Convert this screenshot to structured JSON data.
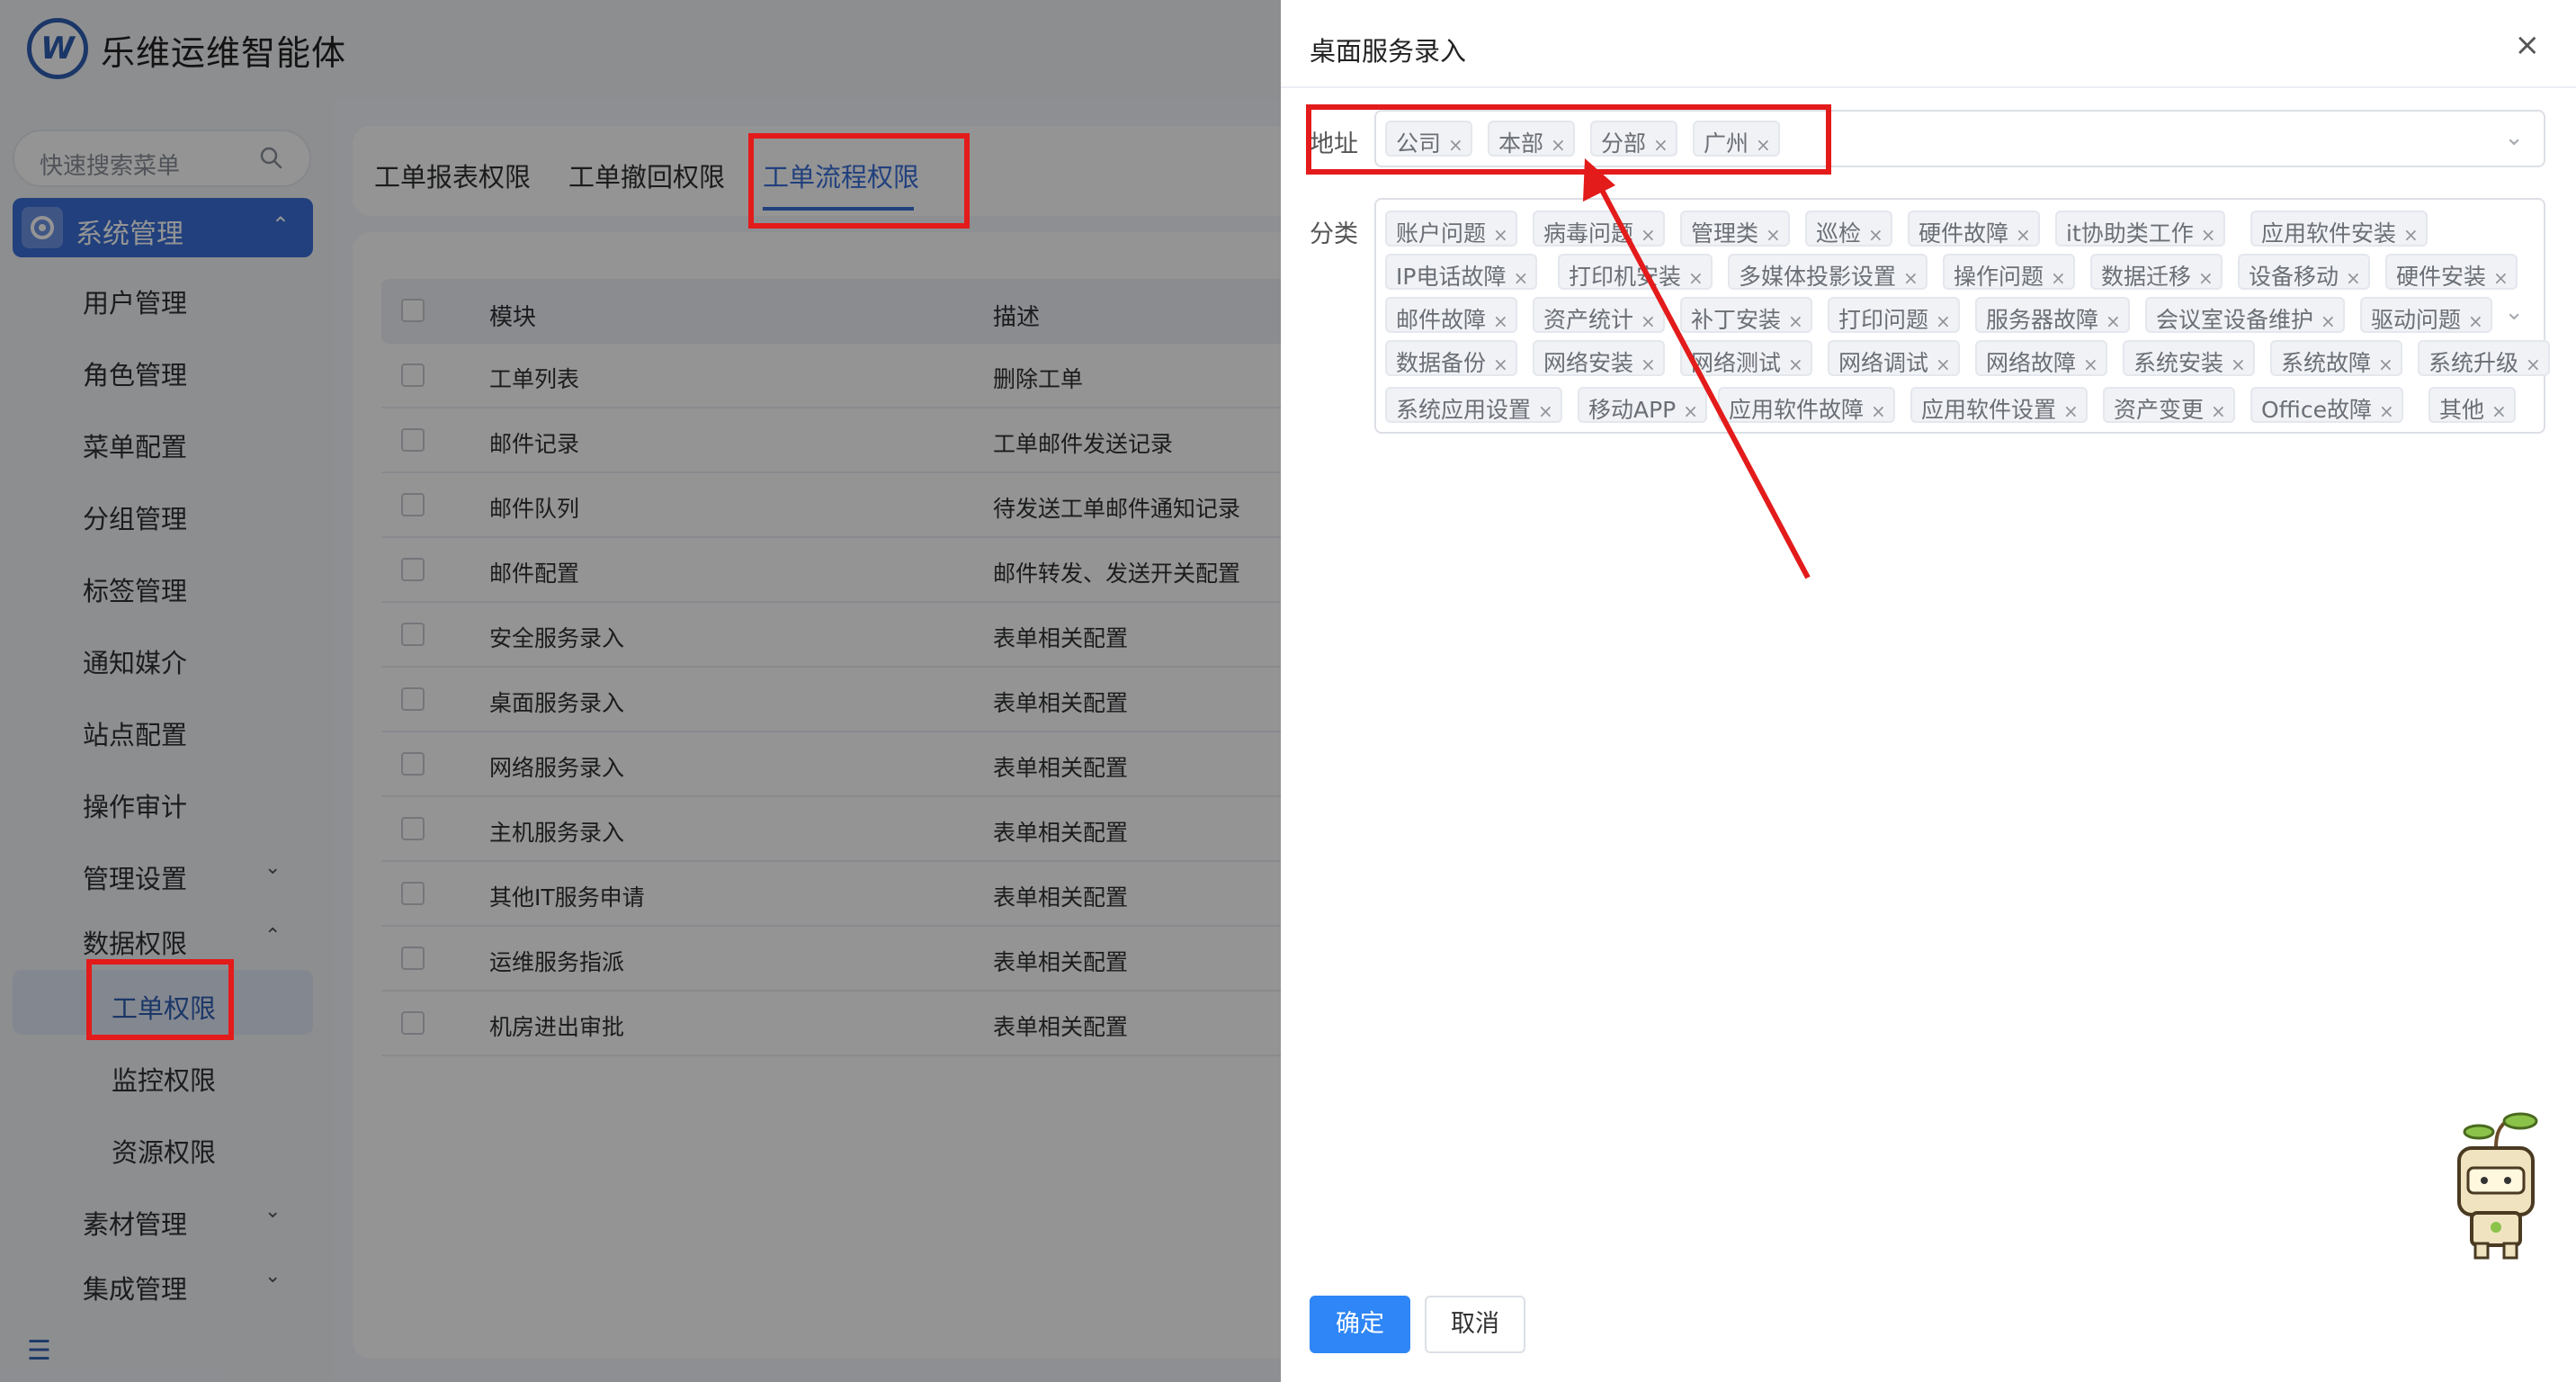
{
  "app": {
    "title": "乐维运维智能体",
    "logo_letter": "W"
  },
  "sidebar": {
    "search_placeholder": "快速搜索菜单",
    "active_parent": "系统管理",
    "items": [
      {
        "label": "用户管理"
      },
      {
        "label": "角色管理"
      },
      {
        "label": "菜单配置"
      },
      {
        "label": "分组管理"
      },
      {
        "label": "标签管理"
      },
      {
        "label": "通知媒介"
      },
      {
        "label": "站点配置"
      },
      {
        "label": "操作审计"
      },
      {
        "label": "管理设置",
        "chevron": "down"
      },
      {
        "label": "数据权限",
        "chevron": "up"
      },
      {
        "label": "工单权限",
        "selected": true
      },
      {
        "label": "监控权限"
      },
      {
        "label": "资源权限"
      },
      {
        "label": "素材管理",
        "chevron": "down"
      },
      {
        "label": "集成管理",
        "chevron": "down"
      }
    ]
  },
  "tabs": [
    {
      "label": "工单报表权限"
    },
    {
      "label": "工单撤回权限"
    },
    {
      "label": "工单流程权限",
      "active": true
    }
  ],
  "table": {
    "headers": [
      "模块",
      "描述"
    ],
    "rows": [
      [
        "工单列表",
        "删除工单"
      ],
      [
        "邮件记录",
        "工单邮件发送记录"
      ],
      [
        "邮件队列",
        "待发送工单邮件通知记录"
      ],
      [
        "邮件配置",
        "邮件转发、发送开关配置"
      ],
      [
        "安全服务录入",
        "表单相关配置"
      ],
      [
        "桌面服务录入",
        "表单相关配置"
      ],
      [
        "网络服务录入",
        "表单相关配置"
      ],
      [
        "主机服务录入",
        "表单相关配置"
      ],
      [
        "其他IT服务申请",
        "表单相关配置"
      ],
      [
        "运维服务指派",
        "表单相关配置"
      ],
      [
        "机房进出审批",
        "表单相关配置"
      ]
    ]
  },
  "drawer": {
    "title": "桌面服务录入",
    "close": "×",
    "address_label": "地址",
    "address_tags": [
      "公司",
      "本部",
      "分部",
      "广州"
    ],
    "category_label": "分类",
    "category_rows": [
      [
        "账户问题",
        "病毒问题",
        "管理类",
        "巡检",
        "硬件故障",
        "it协助类工作",
        "应用软件安装"
      ],
      [
        "IP电话故障",
        "打印机安装",
        "多媒体投影设置",
        "操作问题",
        "数据迁移",
        "设备移动",
        "硬件安装"
      ],
      [
        "邮件故障",
        "资产统计",
        "补丁安装",
        "打印问题",
        "服务器故障",
        "会议室设备维护",
        "驱动问题"
      ],
      [
        "数据备份",
        "网络安装",
        "网络测试",
        "网络调试",
        "网络故障",
        "系统安装",
        "系统故障",
        "系统升级"
      ],
      [
        "系统应用设置",
        "移动APP",
        "应用软件故障",
        "应用软件设置",
        "资产变更",
        "Office故障",
        "其他"
      ]
    ],
    "confirm": "确定",
    "cancel": "取消"
  },
  "colors": {
    "primary": "#3a6fd8",
    "button_primary": "#2f86f6",
    "annotation": "#e31b1b"
  },
  "icons": [
    "search-icon",
    "gear-icon",
    "close-icon",
    "chevron-down-icon",
    "collapse-icon",
    "tag-close-icon"
  ]
}
